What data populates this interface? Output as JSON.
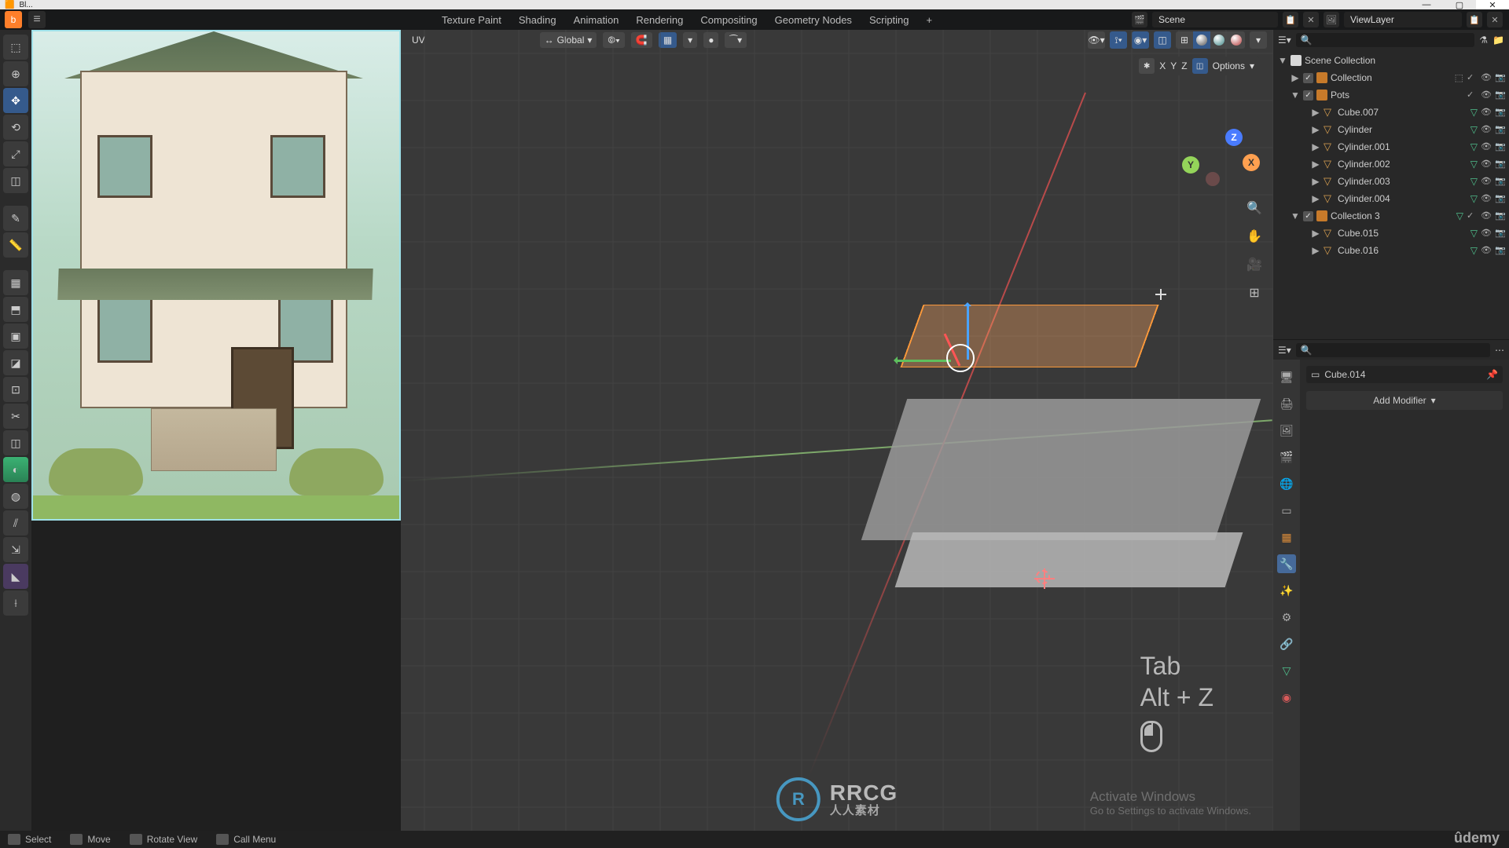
{
  "window": {
    "title": "Bl..."
  },
  "window_controls": {
    "minimize": "—",
    "maximize": "▢",
    "close": "✕"
  },
  "top_tabs": {
    "texturepaint": "Texture Paint",
    "shading": "Shading",
    "animation": "Animation",
    "rendering": "Rendering",
    "compositing": "Compositing",
    "geometrynodes": "Geometry Nodes",
    "scripting": "Scripting",
    "add": "+"
  },
  "scene": {
    "label": "Scene",
    "viewlayer": "ViewLayer"
  },
  "viewport_header": {
    "mode_label": "UV",
    "orientation": "Global",
    "gizmo_xyz": "…"
  },
  "overlay": {
    "x": "X",
    "y": "Y",
    "z": "Z",
    "options": "Options"
  },
  "nav_gizmo": {
    "x": "X",
    "y": "Y",
    "z": "Z"
  },
  "side_icons": {
    "zoom": "🔍",
    "move": "✋",
    "camera": "🎥",
    "grid": "⊞"
  },
  "key_overlay": {
    "line1": "Tab",
    "line2": "Alt + Z"
  },
  "activate": {
    "title": "Activate Windows",
    "sub": "Go to Settings to activate Windows."
  },
  "rrcg": {
    "badge": "R",
    "title": "RRCG",
    "sub": "人人素材"
  },
  "outliner": {
    "search_placeholder": "",
    "scene_collection": "Scene Collection",
    "collection": "Collection",
    "pots": "Pots",
    "items": {
      "cube007": "Cube.007",
      "cylinder": "Cylinder",
      "cylinder001": "Cylinder.001",
      "cylinder002": "Cylinder.002",
      "cylinder003": "Cylinder.003",
      "cylinder004": "Cylinder.004"
    },
    "collection3": "Collection 3",
    "items3": {
      "cube015": "Cube.015",
      "cube016": "Cube.016"
    }
  },
  "properties": {
    "object": "Cube.014",
    "add_modifier": "Add Modifier"
  },
  "statusbar": {
    "select": "Select",
    "move": "Move",
    "rotate": "Rotate View",
    "callmenu": "Call Menu"
  },
  "udemy": "ûdemy"
}
